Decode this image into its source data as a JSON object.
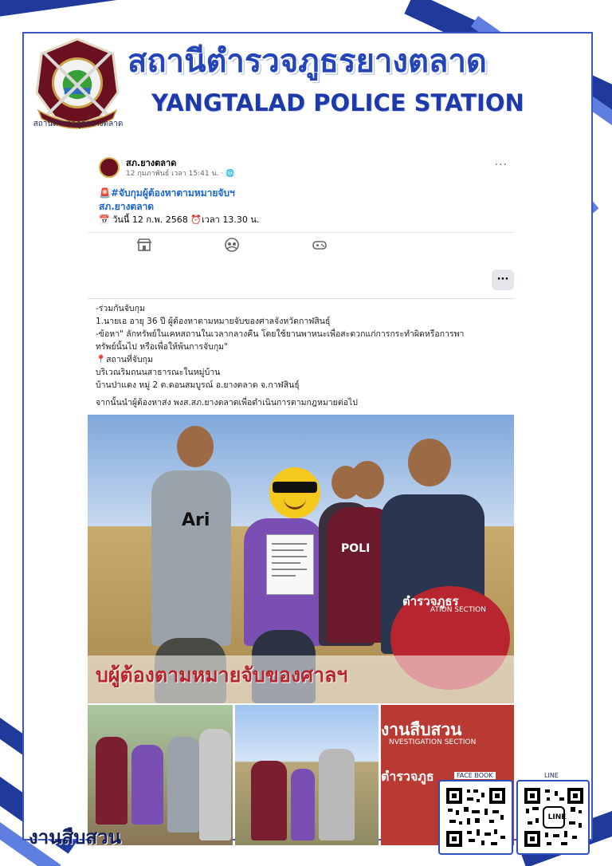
{
  "colors": {
    "frame_blue": "#1f3a9a",
    "title_blue": "#2546b8",
    "facebook_link": "#1b64d1",
    "badge_red": "#b8252e"
  },
  "header": {
    "title_th": "สถานีตำรวจภูธรยางตลาด",
    "title_en": "YANGTALAD POLICE STATION",
    "logo_caption": "สถานีตำรวจภูธรยางตลาด"
  },
  "post": {
    "author": "สภ.ยางตลาด",
    "meta": "12 กุมภาพันธ์ เวลา 15:41 น. · 🌐",
    "more_icon": "···",
    "title": "🚨#จับกุมผู้ต้องหาตามหมายจับฯ",
    "subtitle": "สภ.ยางตลาด",
    "date_line": "📅 วันนี้ 12 ก.พ. 2568   ⏰เวลา 13.30 น.",
    "actions": [
      "shop-icon",
      "group-icon",
      "gaming-icon"
    ]
  },
  "options_button": "···",
  "body_lines": [
    "-ร่วมกันจับกุม",
    "1.นายเอ อายุ 36 ปี ผู้ต้องหาตามหมายจับของศาลจังหวัดกาฬสินธุ์",
    "-ข้อหา\" ลักทรัพย์ในเคหสถานในเวลากลางคืน โดยใช้ยานพาหนะเพื่อสะดวกแก่การกระทำผิดหรือการพา",
    "ทรัพย์นั้นไป หรือเพื่อให้พ้นการจับกุม\"",
    "📍สถานที่จับกุม",
    "บริเวณริมถนนสาธารณะในหมู่บ้าน",
    "บ้านป่าแดง หมู่ 2 ต.ดอนสมบูรณ์ อ.ยางตลาด จ.กาฬสินธุ์",
    "",
    "จากนั้นนำผู้ต้องหาส่ง พงส.สภ.ยางตลาดเพื่อดำเนินการตามกฎหมายต่อไป"
  ],
  "photo": {
    "banner": "บผู้ต้องตามหมายจับของศาลฯ",
    "badge_text": "ตำรวจภูธร",
    "badge_sub": "ATION SECTION",
    "shirt_text": "Ari",
    "vest_text": "POLI"
  },
  "thumb3": {
    "title": "งานสืบสวน",
    "sub": "NVESTIGATION SECTION",
    "title2": "ตำรวจภูธ"
  },
  "qr": {
    "facebook_label": "FACE BOOK",
    "line_label": "LINE",
    "line_center": "LINE"
  },
  "footer": {
    "label": "งานสืบสวน"
  }
}
